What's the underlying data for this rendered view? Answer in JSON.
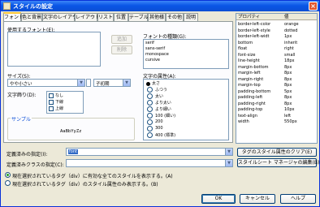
{
  "window": {
    "title": "スタイルの設定"
  },
  "tabs": [
    "フォント",
    "色と背景",
    "文字のレイアウト",
    "レイアウト",
    "リスト",
    "位置",
    "テーブル",
    "其他様",
    "その他",
    "説明"
  ],
  "font": {
    "used_fonts_label": "使用するフォント(E):",
    "add_button": "追加",
    "delete_button": "削除",
    "font_type_label": "フォントの種類(G):",
    "font_types": [
      "serif",
      "sans-serif",
      "monospace",
      "cursive"
    ],
    "size_label": "サイズ(S):",
    "size_value": "やや小さい",
    "size_unit": "子初期",
    "text_decoration_label": "文字飾り(D):",
    "decorations": [
      "なし",
      "下線",
      "上線"
    ],
    "sample_label": "サンプル",
    "sample_text": "AaBbYyZz",
    "font_style_label": "文字の属性(A):",
    "font_styles": [
      "太さ",
      "ふつう",
      "太い",
      "より太い",
      "より細い",
      "100 (細い)",
      "200",
      "300",
      "400 (標準)"
    ]
  },
  "properties": {
    "header_name": "プロパティ",
    "header_value": "値",
    "rows": [
      {
        "name": "border-left-color",
        "value": "orange"
      },
      {
        "name": "border-left-style",
        "value": "dotted"
      },
      {
        "name": "border-left-widt",
        "value": "1px"
      },
      {
        "name": "bottom",
        "value": "inherit"
      },
      {
        "name": "float",
        "value": "right"
      },
      {
        "name": "font-size",
        "value": "small"
      },
      {
        "name": "line-height",
        "value": "18px"
      },
      {
        "name": "margin-bottom",
        "value": "8px"
      },
      {
        "name": "margin-left",
        "value": "8px"
      },
      {
        "name": "margin-right",
        "value": "8px"
      },
      {
        "name": "margin-top",
        "value": "8px"
      },
      {
        "name": "padding-bottom",
        "value": "5px"
      },
      {
        "name": "padding-left",
        "value": "8px"
      },
      {
        "name": "padding-right",
        "value": "8px"
      },
      {
        "name": "padding-top",
        "value": "10px"
      },
      {
        "name": "text-align",
        "value": "left"
      },
      {
        "name": "width",
        "value": "550px"
      }
    ]
  },
  "bottom": {
    "defined_style_label": "定義済みの指定(I):",
    "defined_style_value": "font",
    "clear_button": "タグのスタイル属性のクリア(E)",
    "defined_class_label": "定義済みクラスの指定(C):",
    "stylesheet_button": "スタイルシート マネージャの編集(B)",
    "radio1_label": "現在選択されているタグ（div）に有効な全てのスタイルを表示する。(A)",
    "radio2_label": "現在選択されているタグ（div）のスタイル属性のみ表示する。(B)",
    "ok_button": "OK",
    "cancel_button": "キャンセル",
    "help_button": "ヘルプ"
  }
}
